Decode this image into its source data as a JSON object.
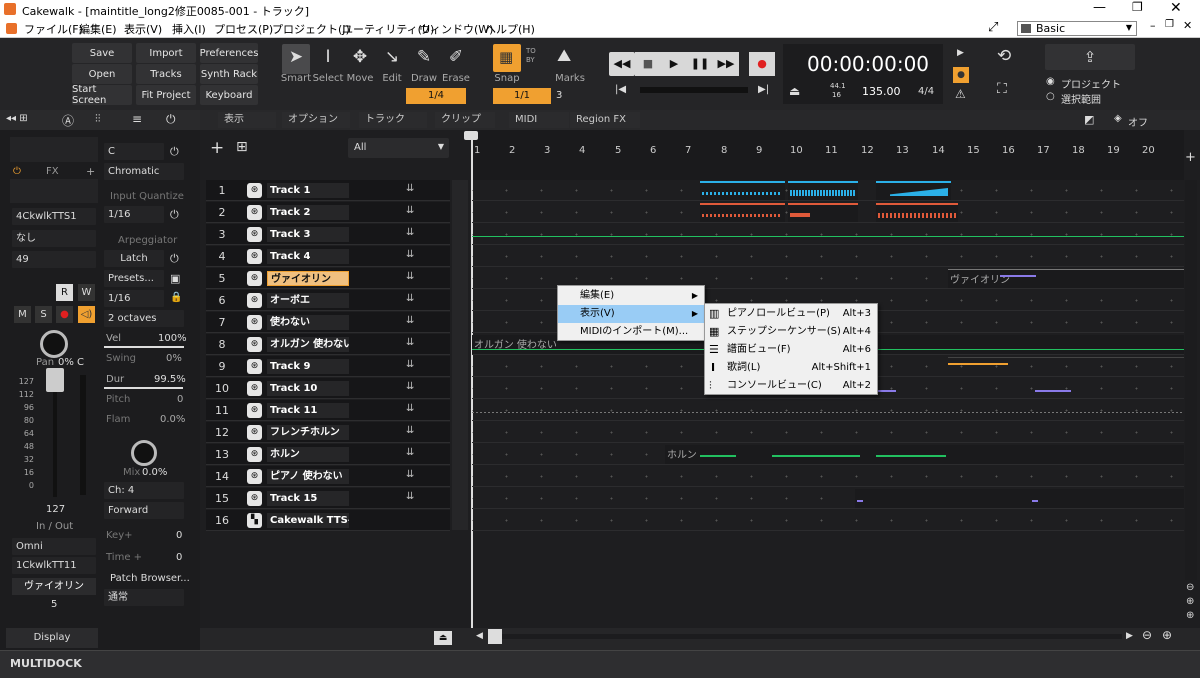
{
  "window": {
    "title": "Cakewalk - [maintitle_long2修正0085-001 - トラック]"
  },
  "menu": [
    "ファイル(F)",
    "編集(E)",
    "表示(V)",
    "挿入(I)",
    "プロセス(P)",
    "プロジェクト(J)",
    "ユーティリティ(U)",
    "ウィンドウ(W)",
    "ヘルプ(H)"
  ],
  "workspace": "Basic",
  "toolbar": {
    "buttons": [
      "Save",
      "Import",
      "Preferences",
      "Open",
      "Tracks",
      "Synth Rack",
      "Start Screen",
      "Fit Project",
      "Keyboard"
    ],
    "tools": [
      "Smart",
      "Select",
      "Move",
      "Edit",
      "Draw",
      "Erase"
    ],
    "snap_label": "Snap",
    "snap_value": "1/1",
    "snap_aux": "3",
    "marks_label": "Marks",
    "draw_value": "1/4",
    "time": "00:00:00:00",
    "tempo": "135.00",
    "meter": "4/4",
    "tempo_small_a": "44.1",
    "tempo_small_b": "16",
    "scope": [
      "プロジェクト",
      "選択範囲"
    ]
  },
  "inspector": {
    "fx_label": "FX",
    "inputs": [
      "4CkwlkTTS1",
      "なし",
      "49"
    ],
    "key": "C",
    "scale": "Chromatic",
    "input_quantize_label": "Input Quantize",
    "input_quantize": "1/16",
    "arp_label": "Arpeggiator",
    "latch": "Latch",
    "presets": "Presets...",
    "arp_rate": "1/16",
    "arp_range": "2 octaves",
    "params": [
      {
        "label": "Vel",
        "value": "100%"
      },
      {
        "label": "Swing",
        "value": "0%"
      },
      {
        "label": "Dur",
        "value": "99.5%"
      },
      {
        "label": "Pitch",
        "value": "0"
      },
      {
        "label": "Flam",
        "value": "0.0%"
      }
    ],
    "mix_label": "Mix",
    "mix_value": "0.0%",
    "channel": "Ch: 4",
    "direction": "Forward",
    "keyplus_label": "Key+",
    "keyplus_value": "0",
    "time_label": "Time +",
    "time_value": "0",
    "patch_browser": "Patch Browser...",
    "mode": "通常",
    "pan_label": "Pan",
    "pan_value": "0% C",
    "fader_scale": [
      "127",
      "112",
      "96",
      "80",
      "64",
      "48",
      "32",
      "16",
      "0"
    ],
    "fader_value": "127",
    "inout_label": "In / Out",
    "in_port": "Omni",
    "out_port": "1CkwlkTT11",
    "track_name": "ヴァイオリン",
    "track_number": "5",
    "display_label": "Display",
    "rw": [
      "R",
      "W"
    ],
    "msr": [
      "M",
      "S"
    ]
  },
  "trackview": {
    "menus": [
      "表示",
      "オプション",
      "トラック",
      "クリップ",
      "MIDI",
      "Region FX"
    ],
    "filter": "All",
    "off_label": "オフ",
    "ruler": [
      "1",
      "2",
      "3",
      "4",
      "5",
      "6",
      "7",
      "8",
      "9",
      "10",
      "11",
      "12",
      "13",
      "14",
      "15",
      "16",
      "17",
      "18",
      "19",
      "20"
    ],
    "tracks": [
      {
        "num": "1",
        "name": "Track 1"
      },
      {
        "num": "2",
        "name": "Track 2"
      },
      {
        "num": "3",
        "name": "Track 3"
      },
      {
        "num": "4",
        "name": "Track 4"
      },
      {
        "num": "5",
        "name": "ヴァイオリン"
      },
      {
        "num": "6",
        "name": "オーボエ"
      },
      {
        "num": "7",
        "name": "使わない"
      },
      {
        "num": "8",
        "name": "オルガン 使わない"
      },
      {
        "num": "9",
        "name": "Track 9"
      },
      {
        "num": "10",
        "name": "Track 10"
      },
      {
        "num": "11",
        "name": "Track 11"
      },
      {
        "num": "12",
        "name": "フレンチホルン"
      },
      {
        "num": "13",
        "name": "ホルン"
      },
      {
        "num": "14",
        "name": "ピアノ 使わない"
      },
      {
        "num": "15",
        "name": "Track 15"
      },
      {
        "num": "16",
        "name": "Cakewalk TTS-"
      }
    ],
    "clip_labels": {
      "violin": "ヴァイオリン",
      "organ": "オルガン 使わない",
      "horn": "ホルン"
    }
  },
  "context_menu": {
    "items": [
      "編集(E)",
      "表示(V)",
      "MIDIのインポート(M)..."
    ],
    "submenu": [
      {
        "label": "ピアノロールビュー(P)",
        "shortcut": "Alt+3"
      },
      {
        "label": "ステップシーケンサー(S)",
        "shortcut": "Alt+4"
      },
      {
        "label": "譜面ビュー(F)",
        "shortcut": "Alt+6"
      },
      {
        "label": "歌詞(L)",
        "shortcut": "Alt+Shift+1"
      },
      {
        "label": "コンソールビュー(C)",
        "shortcut": "Alt+2"
      }
    ]
  },
  "multidock": "MULTIDOCK",
  "colors": {
    "accent": "#f0a030",
    "midi_blue": "#2bb0e8",
    "midi_red": "#e05a3a",
    "midi_green": "#22c060",
    "midi_purple": "#8a7ae8",
    "menu_highlight": "#99ccf5"
  }
}
